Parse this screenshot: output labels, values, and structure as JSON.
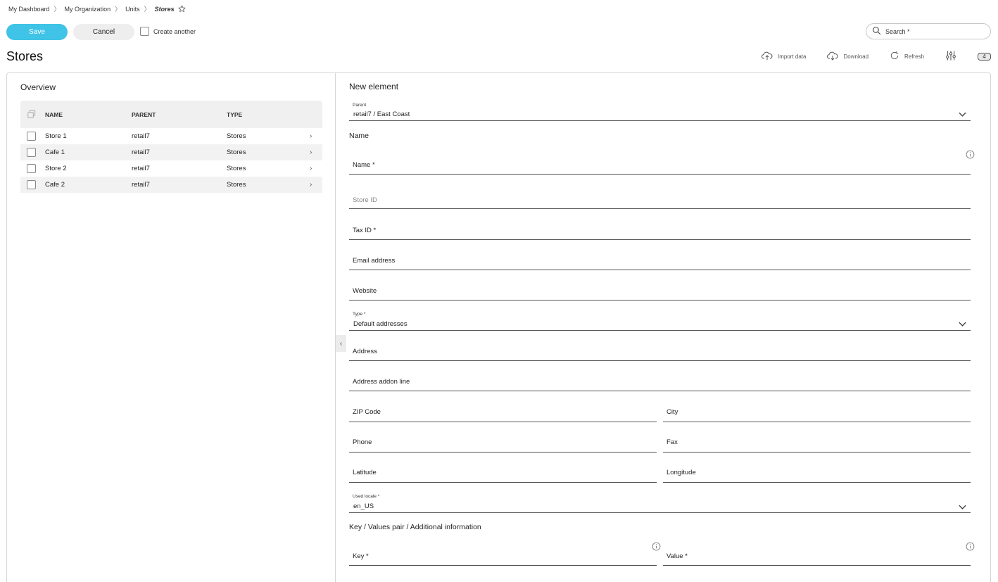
{
  "breadcrumb": {
    "items": [
      "My Dashboard",
      "My Organization",
      "Units"
    ],
    "current": "Stores",
    "separator": "〉"
  },
  "toolbar": {
    "save_label": "Save",
    "cancel_label": "Cancel",
    "create_another_label": "Create another",
    "search_placeholder": "Search *"
  },
  "page": {
    "title": "Stores"
  },
  "actions": {
    "import_label": "Import data",
    "download_label": "Download",
    "refresh_label": "Refresh",
    "filter_count": "4"
  },
  "overview": {
    "title": "Overview",
    "columns": {
      "name": "NAME",
      "parent": "PARENT",
      "type": "TYPE"
    },
    "rows": [
      {
        "name": "Store 1",
        "parent": "retail7",
        "type": "Stores"
      },
      {
        "name": "Cafe 1",
        "parent": "retail7",
        "type": "Stores"
      },
      {
        "name": "Store 2",
        "parent": "retail7",
        "type": "Stores"
      },
      {
        "name": "Cafe 2",
        "parent": "retail7",
        "type": "Stores"
      }
    ]
  },
  "form": {
    "title": "New element",
    "parent_label": "Parent",
    "parent_value": "retail7 / East Coast",
    "name_section": "Name",
    "name_label": "Name *",
    "store_id_placeholder": "Store ID",
    "tax_id_label": "Tax ID *",
    "email_label": "Email address",
    "website_label": "Website",
    "type_label": "Type *",
    "type_value": "Default addresses",
    "address_label": "Address",
    "address_addon_label": "Address addon line",
    "zip_label": "ZIP Code",
    "city_label": "City",
    "phone_label": "Phone",
    "fax_label": "Fax",
    "latitude_label": "Latitude",
    "longitude_label": "Longitude",
    "locale_label": "Used locale *",
    "locale_value": "en_US",
    "kv_section": "Key / Values pair / Additional information",
    "key_label": "Key *",
    "value_label": "Value *"
  },
  "colors": {
    "accent": "#3fc3e6",
    "cancel_bg": "#eeeeee",
    "row_alt": "#f2f2f2"
  }
}
